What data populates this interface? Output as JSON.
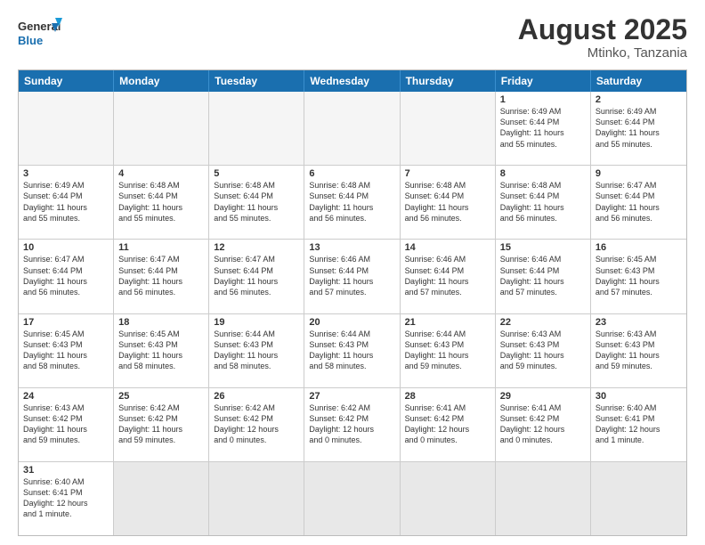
{
  "header": {
    "logo_general": "General",
    "logo_blue": "Blue",
    "month_title": "August 2025",
    "location": "Mtinko, Tanzania"
  },
  "weekdays": [
    "Sunday",
    "Monday",
    "Tuesday",
    "Wednesday",
    "Thursday",
    "Friday",
    "Saturday"
  ],
  "rows": [
    [
      {
        "day": "",
        "info": ""
      },
      {
        "day": "",
        "info": ""
      },
      {
        "day": "",
        "info": ""
      },
      {
        "day": "",
        "info": ""
      },
      {
        "day": "",
        "info": ""
      },
      {
        "day": "1",
        "info": "Sunrise: 6:49 AM\nSunset: 6:44 PM\nDaylight: 11 hours\nand 55 minutes."
      },
      {
        "day": "2",
        "info": "Sunrise: 6:49 AM\nSunset: 6:44 PM\nDaylight: 11 hours\nand 55 minutes."
      }
    ],
    [
      {
        "day": "3",
        "info": "Sunrise: 6:49 AM\nSunset: 6:44 PM\nDaylight: 11 hours\nand 55 minutes."
      },
      {
        "day": "4",
        "info": "Sunrise: 6:48 AM\nSunset: 6:44 PM\nDaylight: 11 hours\nand 55 minutes."
      },
      {
        "day": "5",
        "info": "Sunrise: 6:48 AM\nSunset: 6:44 PM\nDaylight: 11 hours\nand 55 minutes."
      },
      {
        "day": "6",
        "info": "Sunrise: 6:48 AM\nSunset: 6:44 PM\nDaylight: 11 hours\nand 56 minutes."
      },
      {
        "day": "7",
        "info": "Sunrise: 6:48 AM\nSunset: 6:44 PM\nDaylight: 11 hours\nand 56 minutes."
      },
      {
        "day": "8",
        "info": "Sunrise: 6:48 AM\nSunset: 6:44 PM\nDaylight: 11 hours\nand 56 minutes."
      },
      {
        "day": "9",
        "info": "Sunrise: 6:47 AM\nSunset: 6:44 PM\nDaylight: 11 hours\nand 56 minutes."
      }
    ],
    [
      {
        "day": "10",
        "info": "Sunrise: 6:47 AM\nSunset: 6:44 PM\nDaylight: 11 hours\nand 56 minutes."
      },
      {
        "day": "11",
        "info": "Sunrise: 6:47 AM\nSunset: 6:44 PM\nDaylight: 11 hours\nand 56 minutes."
      },
      {
        "day": "12",
        "info": "Sunrise: 6:47 AM\nSunset: 6:44 PM\nDaylight: 11 hours\nand 56 minutes."
      },
      {
        "day": "13",
        "info": "Sunrise: 6:46 AM\nSunset: 6:44 PM\nDaylight: 11 hours\nand 57 minutes."
      },
      {
        "day": "14",
        "info": "Sunrise: 6:46 AM\nSunset: 6:44 PM\nDaylight: 11 hours\nand 57 minutes."
      },
      {
        "day": "15",
        "info": "Sunrise: 6:46 AM\nSunset: 6:44 PM\nDaylight: 11 hours\nand 57 minutes."
      },
      {
        "day": "16",
        "info": "Sunrise: 6:45 AM\nSunset: 6:43 PM\nDaylight: 11 hours\nand 57 minutes."
      }
    ],
    [
      {
        "day": "17",
        "info": "Sunrise: 6:45 AM\nSunset: 6:43 PM\nDaylight: 11 hours\nand 58 minutes."
      },
      {
        "day": "18",
        "info": "Sunrise: 6:45 AM\nSunset: 6:43 PM\nDaylight: 11 hours\nand 58 minutes."
      },
      {
        "day": "19",
        "info": "Sunrise: 6:44 AM\nSunset: 6:43 PM\nDaylight: 11 hours\nand 58 minutes."
      },
      {
        "day": "20",
        "info": "Sunrise: 6:44 AM\nSunset: 6:43 PM\nDaylight: 11 hours\nand 58 minutes."
      },
      {
        "day": "21",
        "info": "Sunrise: 6:44 AM\nSunset: 6:43 PM\nDaylight: 11 hours\nand 59 minutes."
      },
      {
        "day": "22",
        "info": "Sunrise: 6:43 AM\nSunset: 6:43 PM\nDaylight: 11 hours\nand 59 minutes."
      },
      {
        "day": "23",
        "info": "Sunrise: 6:43 AM\nSunset: 6:43 PM\nDaylight: 11 hours\nand 59 minutes."
      }
    ],
    [
      {
        "day": "24",
        "info": "Sunrise: 6:43 AM\nSunset: 6:42 PM\nDaylight: 11 hours\nand 59 minutes."
      },
      {
        "day": "25",
        "info": "Sunrise: 6:42 AM\nSunset: 6:42 PM\nDaylight: 11 hours\nand 59 minutes."
      },
      {
        "day": "26",
        "info": "Sunrise: 6:42 AM\nSunset: 6:42 PM\nDaylight: 12 hours\nand 0 minutes."
      },
      {
        "day": "27",
        "info": "Sunrise: 6:42 AM\nSunset: 6:42 PM\nDaylight: 12 hours\nand 0 minutes."
      },
      {
        "day": "28",
        "info": "Sunrise: 6:41 AM\nSunset: 6:42 PM\nDaylight: 12 hours\nand 0 minutes."
      },
      {
        "day": "29",
        "info": "Sunrise: 6:41 AM\nSunset: 6:42 PM\nDaylight: 12 hours\nand 0 minutes."
      },
      {
        "day": "30",
        "info": "Sunrise: 6:40 AM\nSunset: 6:41 PM\nDaylight: 12 hours\nand 1 minute."
      }
    ],
    [
      {
        "day": "31",
        "info": "Sunrise: 6:40 AM\nSunset: 6:41 PM\nDaylight: 12 hours\nand 1 minute."
      },
      {
        "day": "",
        "info": ""
      },
      {
        "day": "",
        "info": ""
      },
      {
        "day": "",
        "info": ""
      },
      {
        "day": "",
        "info": ""
      },
      {
        "day": "",
        "info": ""
      },
      {
        "day": "",
        "info": ""
      }
    ]
  ]
}
